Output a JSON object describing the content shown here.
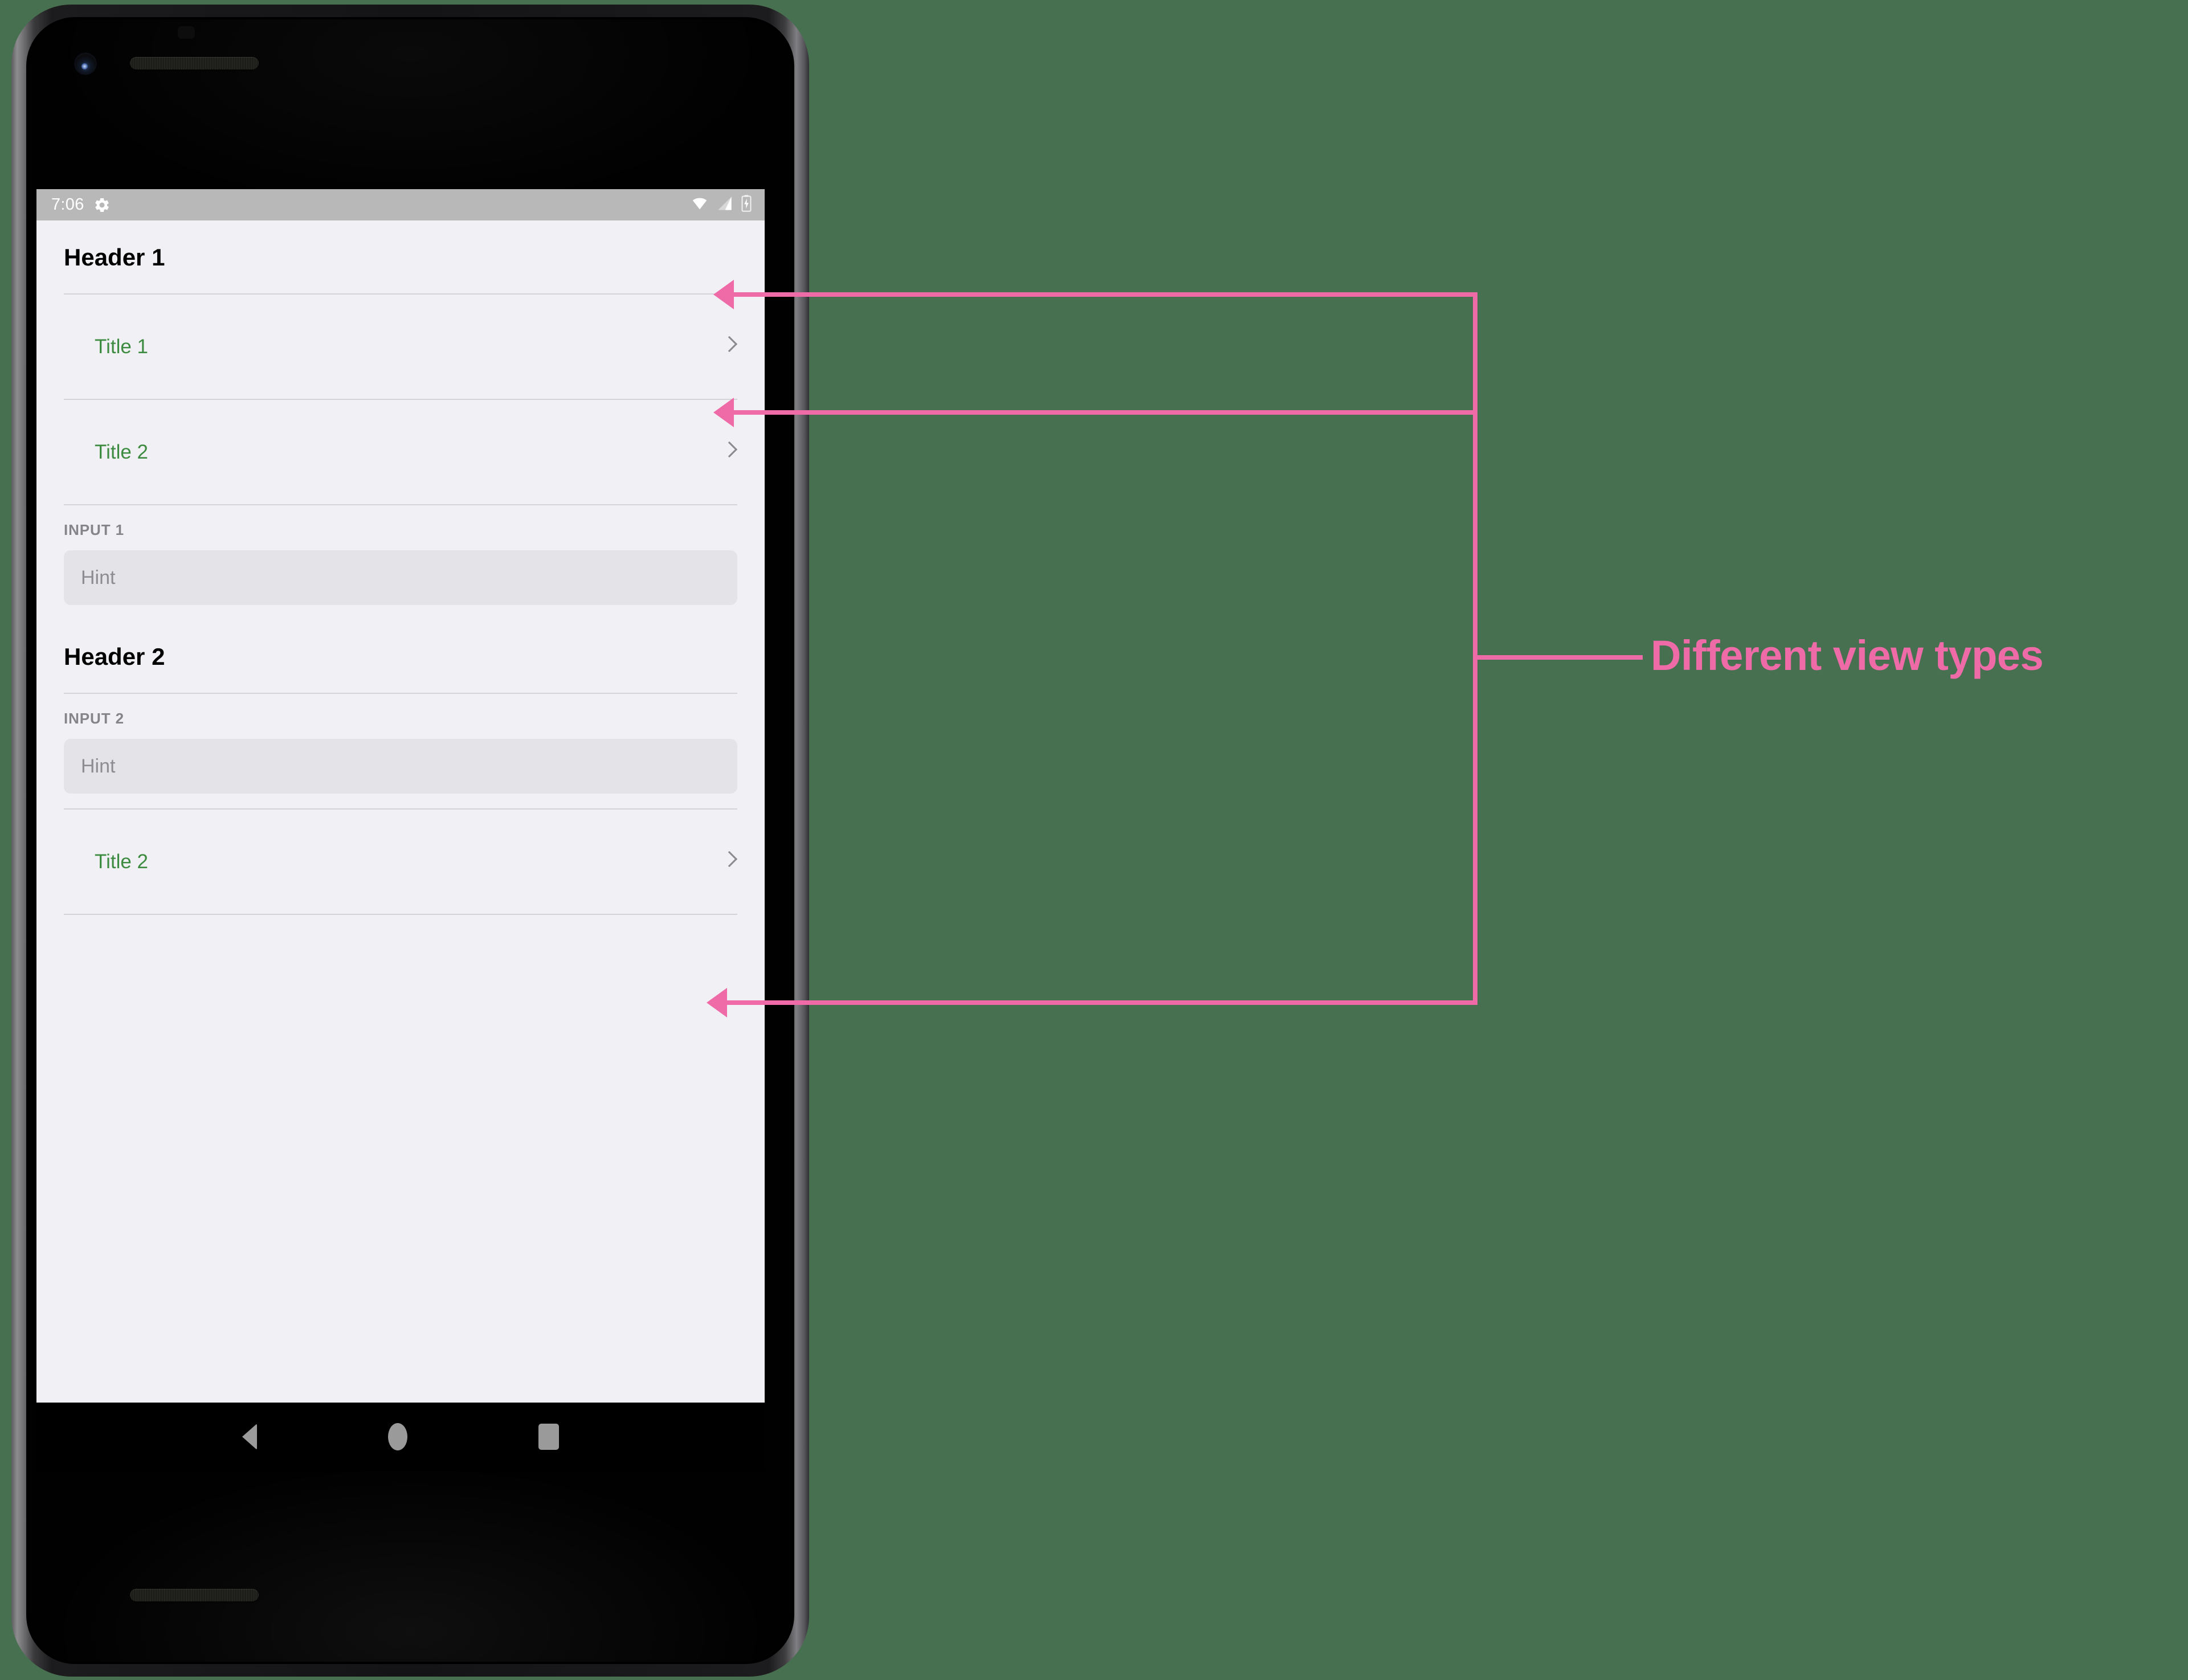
{
  "colors": {
    "page_background": "#477050",
    "annotation_pink": "#ee6ba8",
    "screen_background": "#f1f1f5",
    "status_bar": "#b8b8b8",
    "title_green": "#3d8b40",
    "input_background": "#e3e3e8",
    "divider": "#d4d4d8",
    "label_gray": "#84848a",
    "hint_gray": "#8c8c92",
    "navbar_icon": "#9a9a9a"
  },
  "status_bar": {
    "time": "7:06",
    "gear_icon": "gear-icon",
    "wifi_icon": "wifi-icon",
    "signal_icon": "signal-icon",
    "battery_icon": "battery-charging-icon"
  },
  "app": {
    "sections": [
      {
        "header": "Header 1",
        "rows": [
          {
            "type": "list",
            "title": "Title 1",
            "chevron": "chevron-right-icon"
          },
          {
            "type": "list",
            "title": "Title 2",
            "chevron": "chevron-right-icon"
          },
          {
            "type": "input",
            "label": "INPUT 1",
            "hint": "Hint",
            "value": ""
          }
        ]
      },
      {
        "header": "Header 2",
        "rows": [
          {
            "type": "input",
            "label": "INPUT 2",
            "hint": "Hint",
            "value": ""
          },
          {
            "type": "list",
            "title": "Title 2",
            "chevron": "chevron-right-icon"
          }
        ]
      }
    ]
  },
  "navbar": {
    "back": "back-button",
    "home": "home-button",
    "recents": "recents-button"
  },
  "annotation": {
    "label": "Different view types",
    "targets": [
      "Header 1",
      "Title 1",
      "INPUT 2 field"
    ]
  }
}
